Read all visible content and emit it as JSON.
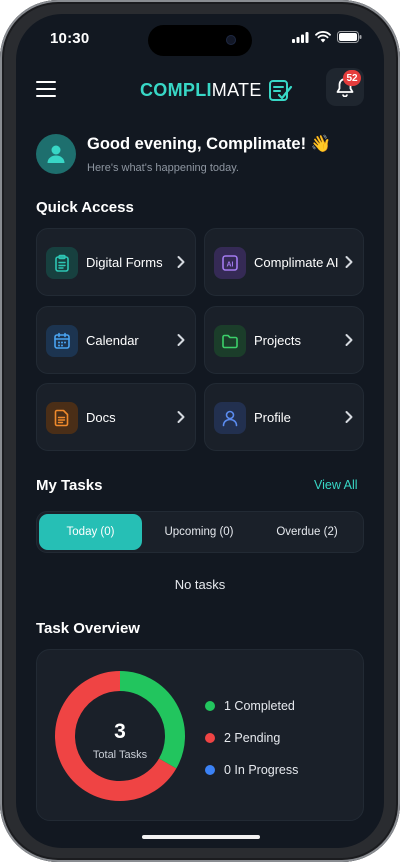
{
  "status_bar": {
    "time": "10:30"
  },
  "header": {
    "logo_text_main": "COMPLI",
    "logo_text_rest": "MATE",
    "notifications_count": "52"
  },
  "greeting": {
    "title": "Good evening, Complimate! 👋",
    "subtitle": "Here's what's happening today."
  },
  "quick_access": {
    "title": "Quick Access",
    "items": [
      {
        "label": "Digital Forms",
        "icon": "clipboard-icon",
        "color": "#2dc6b4",
        "bg": "#17403f"
      },
      {
        "label": "Complimate AI",
        "icon": "ai-icon",
        "color": "#a37bf0",
        "bg": "#352a55"
      },
      {
        "label": "Calendar",
        "icon": "calendar-icon",
        "color": "#4aa3f0",
        "bg": "#1c3450"
      },
      {
        "label": "Projects",
        "icon": "folder-icon",
        "color": "#3ccf6a",
        "bg": "#1b3d2a"
      },
      {
        "label": "Docs",
        "icon": "document-icon",
        "color": "#f08a2c",
        "bg": "#4a2e17"
      },
      {
        "label": "Profile",
        "icon": "user-icon",
        "color": "#5b8cf0",
        "bg": "#22304f"
      }
    ]
  },
  "tasks": {
    "title": "My Tasks",
    "view_all": "View All",
    "tabs": [
      {
        "label": "Today (0)",
        "active": true
      },
      {
        "label": "Upcoming (0)",
        "active": false
      },
      {
        "label": "Overdue (2)",
        "active": false
      }
    ],
    "empty_text": "No tasks"
  },
  "overview": {
    "title": "Task Overview",
    "total_value": "3",
    "total_label": "Total Tasks",
    "legend": [
      {
        "label": "1 Completed",
        "value": 1,
        "color": "#22c55e"
      },
      {
        "label": "2 Pending",
        "value": 2,
        "color": "#ef4444"
      },
      {
        "label": "0 In Progress",
        "value": 0,
        "color": "#3b82f6"
      }
    ]
  },
  "colors": {
    "accent": "#38d7c6",
    "background": "#121821",
    "card": "#1a2029"
  }
}
